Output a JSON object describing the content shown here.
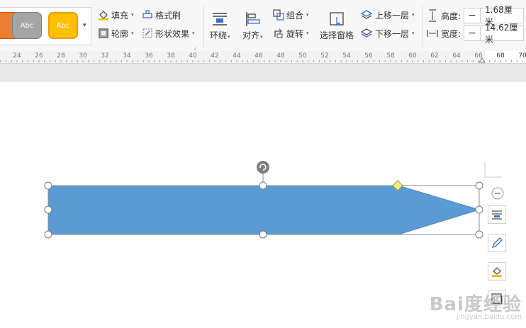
{
  "ribbon": {
    "styles": [
      "Abc",
      "Abc"
    ],
    "fill_label": "填充",
    "format_painter_label": "格式刷",
    "outline_label": "轮廓",
    "shape_effects_label": "形状效果",
    "wrap_label": "环绕",
    "align_label": "对齐",
    "group_label": "组合",
    "rotate_label": "旋转",
    "selection_pane_label": "选择窗格",
    "bring_forward_label": "上移一层",
    "send_backward_label": "下移一层",
    "height_label": "高度:",
    "height_value": "1.68厘米",
    "width_label": "宽度:",
    "width_value": "14.62厘米",
    "minus_symbol": "−"
  },
  "ruler": {
    "ticks": [
      "24",
      "26",
      "28",
      "30",
      "32",
      "34",
      "36",
      "38",
      "40",
      "42",
      "44",
      "46",
      "48",
      "50",
      "52",
      "54",
      "56",
      "58",
      "60",
      "62",
      "64",
      "66",
      "68",
      "70"
    ]
  },
  "shape": {
    "fill_color": "#5b9bd5"
  },
  "watermark": {
    "main": "Bai度经验",
    "sub": "jingyan.baidu.com"
  },
  "colors": {
    "orange": "#ed7d31",
    "gray": "#a5a5a5",
    "gold": "#ffc000"
  }
}
